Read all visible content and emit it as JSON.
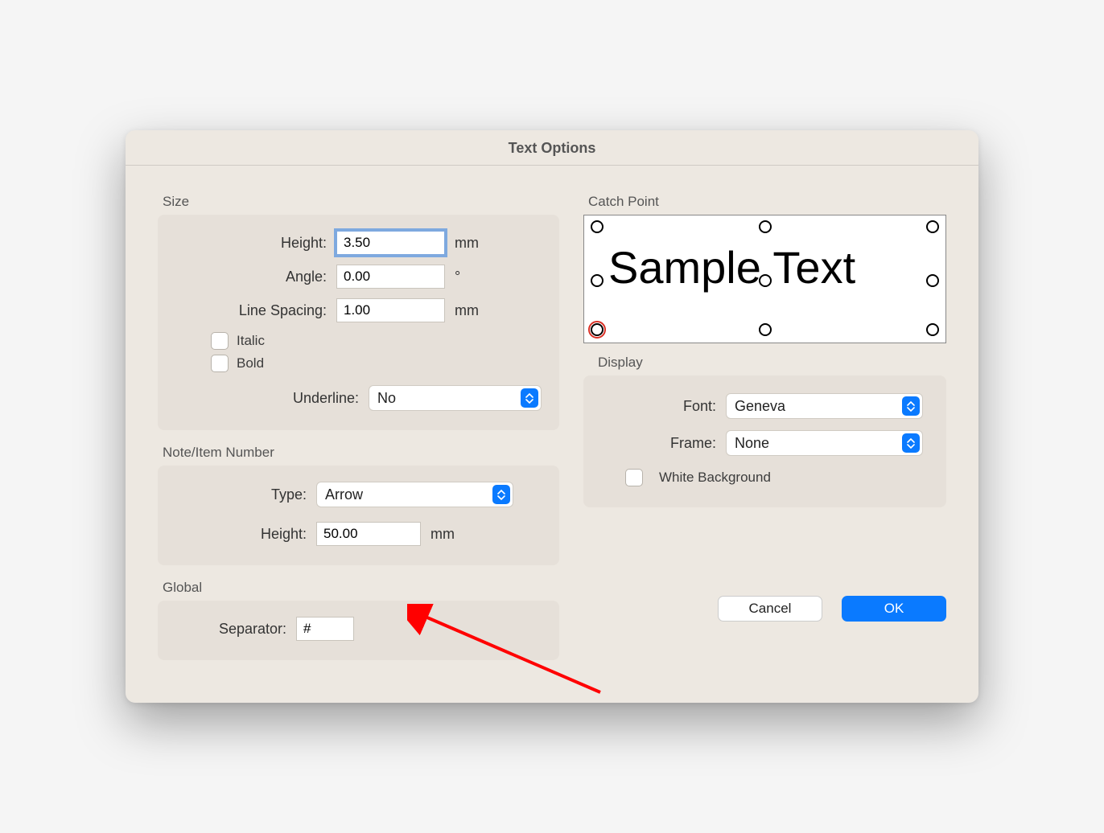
{
  "dialog": {
    "title": "Text Options"
  },
  "size": {
    "group_label": "Size",
    "height_label": "Height:",
    "height_value": "3.50",
    "height_unit": "mm",
    "angle_label": "Angle:",
    "angle_value": "0.00",
    "angle_unit": "°",
    "line_spacing_label": "Line Spacing:",
    "line_spacing_value": "1.00",
    "line_spacing_unit": "mm",
    "italic_label": "Italic",
    "italic_checked": false,
    "bold_label": "Bold",
    "bold_checked": false,
    "underline_label": "Underline:",
    "underline_value": "No"
  },
  "note": {
    "group_label": "Note/Item Number",
    "type_label": "Type:",
    "type_value": "Arrow",
    "height_label": "Height:",
    "height_value": "50.00",
    "height_unit": "mm"
  },
  "global": {
    "group_label": "Global",
    "separator_label": "Separator:",
    "separator_value": "#"
  },
  "catch": {
    "group_label": "Catch Point",
    "sample_text": "Sample Text",
    "selected": "bottom-left"
  },
  "display": {
    "group_label": "Display",
    "font_label": "Font:",
    "font_value": "Geneva",
    "frame_label": "Frame:",
    "frame_value": "None",
    "white_bg_label": "White Background",
    "white_bg_checked": false
  },
  "buttons": {
    "cancel": "Cancel",
    "ok": "OK"
  },
  "colors": {
    "accent": "#0a7aff",
    "arrow": "#ff0000"
  }
}
